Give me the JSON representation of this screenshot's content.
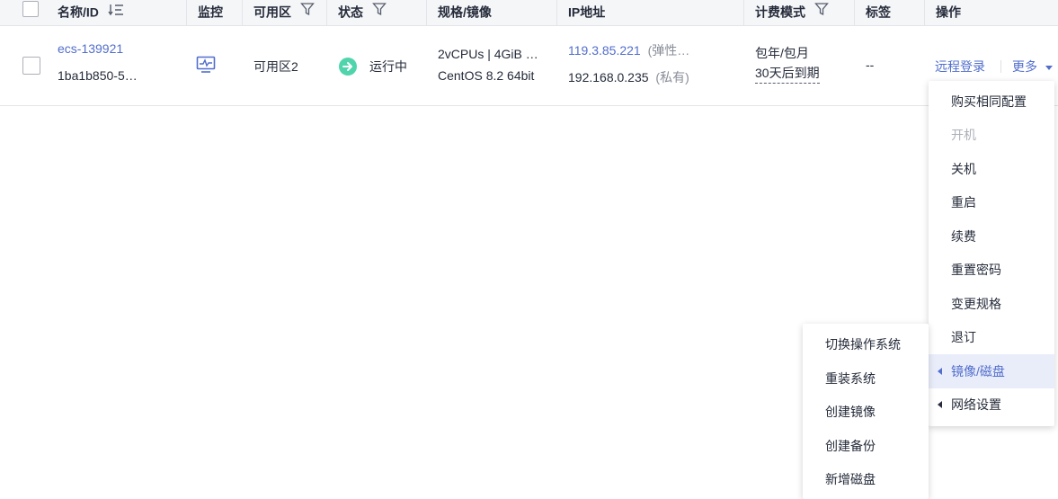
{
  "table": {
    "headers": {
      "name": "名称/ID",
      "monitor": "监控",
      "zone": "可用区",
      "status": "状态",
      "spec": "规格/镜像",
      "ip": "IP地址",
      "billing": "计费模式",
      "tags": "标签",
      "actions": "操作"
    },
    "row": {
      "name": "ecs-139921",
      "id": "1ba1b850-5…",
      "zone": "可用区2",
      "status": "运行中",
      "spec_line1": "2vCPUs | 4GiB …",
      "spec_line2": "CentOS 8.2 64bit",
      "eip": "119.3.85.221",
      "eip_note": "(弹性…",
      "private_ip": "192.168.0.235",
      "private_note": "(私有)",
      "billing_line1": "包年/包月",
      "billing_line2": "30天后到期",
      "tags": "--",
      "remote_login": "远程登录",
      "more": "更多"
    }
  },
  "more_menu": {
    "items": [
      {
        "label": "购买相同配置"
      },
      {
        "label": "开机"
      },
      {
        "label": "关机"
      },
      {
        "label": "重启"
      },
      {
        "label": "续费"
      },
      {
        "label": "重置密码"
      },
      {
        "label": "变更规格"
      },
      {
        "label": "退订"
      },
      {
        "label": "镜像/磁盘"
      },
      {
        "label": "网络设置"
      }
    ]
  },
  "image_submenu": {
    "items": [
      {
        "label": "切换操作系统"
      },
      {
        "label": "重装系统"
      },
      {
        "label": "创建镜像"
      },
      {
        "label": "创建备份"
      },
      {
        "label": "新增磁盘"
      }
    ]
  },
  "colors": {
    "link": "#526ecc",
    "running": "#50d4ab",
    "header_bg": "#f5f6f8",
    "active_bg": "#e9edfa"
  }
}
